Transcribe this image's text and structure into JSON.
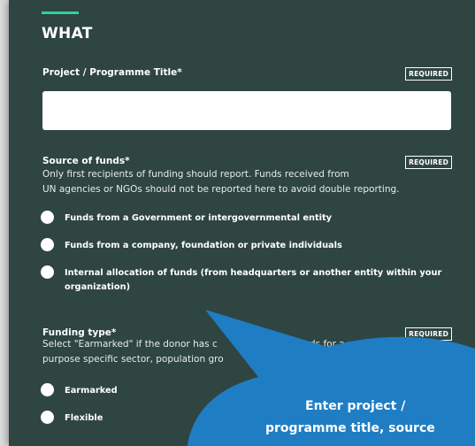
{
  "section": {
    "title": "WHAT"
  },
  "project_title": {
    "label": "Project / Programme Title*",
    "required_badge": "REQUIRED",
    "value": ""
  },
  "source_of_funds": {
    "label": "Source of funds*",
    "required_badge": "REQUIRED",
    "help_line1": "Only first recipients of funding should report. Funds received from",
    "help_line2": "UN agencies or NGOs should not be reported here to avoid double reporting.",
    "options": [
      {
        "label": "Funds from a Government or intergovernmental entity"
      },
      {
        "label": "Funds from a company, foundation or private individuals"
      },
      {
        "label_line1": "Internal allocation of funds (from headquarters or another entity within your",
        "label_line2": "organization)"
      }
    ]
  },
  "funding_type": {
    "label": "Funding type*",
    "required_badge": "REQUIRED",
    "help_line1_a": "Select \"Earmarked\" if the donor has c",
    "help_line1_b": "d funds for a particular",
    "help_line2": "purpose specific sector, population gro",
    "options": [
      {
        "label": "Earmarked"
      },
      {
        "label": "Flexible"
      }
    ]
  },
  "callout": {
    "line1": "Enter project /",
    "line2": "programme title, source"
  },
  "colors": {
    "panel_bg": "#2e4542",
    "accent": "#2ed197",
    "callout_fill": "#1f7dc4"
  }
}
